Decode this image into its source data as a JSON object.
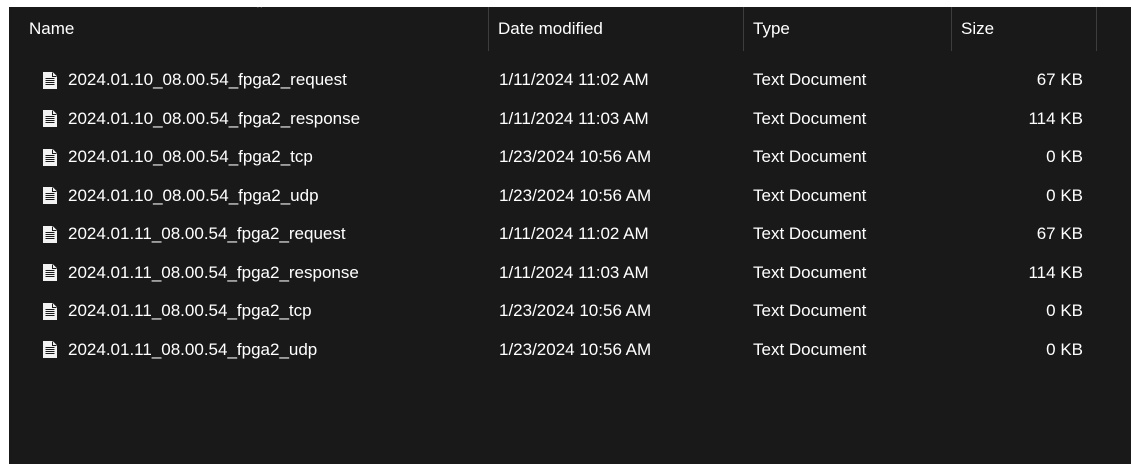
{
  "columns": {
    "name": "Name",
    "date_modified": "Date modified",
    "type": "Type",
    "size": "Size"
  },
  "sort_indicator": "^",
  "colors": {
    "background": "#191919",
    "text": "#ffffff",
    "divider": "#3d3d3d",
    "icon": "#f2f2f2"
  },
  "files": [
    {
      "icon": "text-document-icon",
      "name": "2024.01.10_08.00.54_fpga2_request",
      "date": "1/11/2024 11:02 AM",
      "type": "Text Document",
      "size": "67 KB"
    },
    {
      "icon": "text-document-icon",
      "name": "2024.01.10_08.00.54_fpga2_response",
      "date": "1/11/2024 11:03 AM",
      "type": "Text Document",
      "size": "114 KB"
    },
    {
      "icon": "text-document-icon",
      "name": "2024.01.10_08.00.54_fpga2_tcp",
      "date": "1/23/2024 10:56 AM",
      "type": "Text Document",
      "size": "0 KB"
    },
    {
      "icon": "text-document-icon",
      "name": "2024.01.10_08.00.54_fpga2_udp",
      "date": "1/23/2024 10:56 AM",
      "type": "Text Document",
      "size": "0 KB"
    },
    {
      "icon": "text-document-icon",
      "name": "2024.01.11_08.00.54_fpga2_request",
      "date": "1/11/2024 11:02 AM",
      "type": "Text Document",
      "size": "67 KB"
    },
    {
      "icon": "text-document-icon",
      "name": "2024.01.11_08.00.54_fpga2_response",
      "date": "1/11/2024 11:03 AM",
      "type": "Text Document",
      "size": "114 KB"
    },
    {
      "icon": "text-document-icon",
      "name": "2024.01.11_08.00.54_fpga2_tcp",
      "date": "1/23/2024 10:56 AM",
      "type": "Text Document",
      "size": "0 KB"
    },
    {
      "icon": "text-document-icon",
      "name": "2024.01.11_08.00.54_fpga2_udp",
      "date": "1/23/2024 10:56 AM",
      "type": "Text Document",
      "size": "0 KB"
    }
  ]
}
